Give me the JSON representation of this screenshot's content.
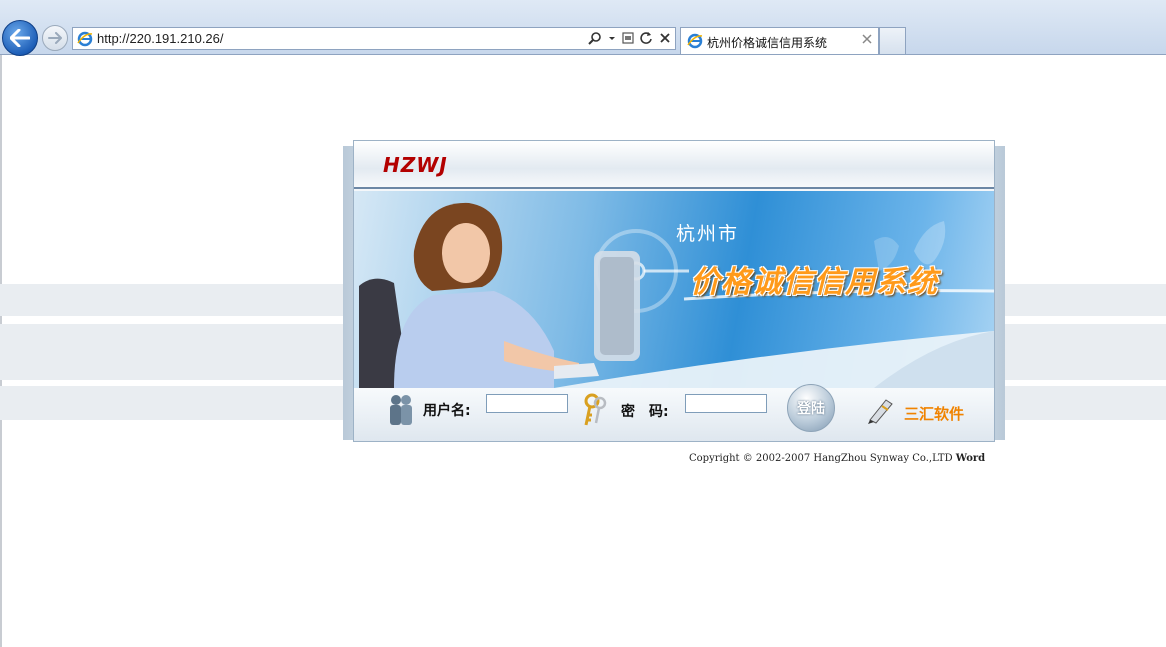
{
  "browser": {
    "url": "http://220.191.210.26/",
    "tab_title": "杭州价格诚信信用系统"
  },
  "login": {
    "brand": "HZWJ",
    "banner_subtitle": "杭州市",
    "banner_title": "价格诚信信用系统",
    "username_label": "用户名:",
    "username_value": "",
    "password_label": "密　码:",
    "password_value": "",
    "login_button": "登陆",
    "vendor": "三汇软件"
  },
  "footer": {
    "copyright": "Copyright © 2002-2007 HangZhou Synway Co.,LTD",
    "copyright_tail": "Word"
  },
  "colors": {
    "brand_red": "#b30000",
    "title_orange": "#ff9a1a",
    "vendor_orange": "#f08300"
  },
  "icons": [
    "back-arrow-icon",
    "forward-arrow-icon",
    "ie-icon",
    "search-icon",
    "dropdown-icon",
    "compat-icon",
    "refresh-icon",
    "stop-icon",
    "close-icon",
    "users-icon",
    "keys-icon",
    "pen-icon"
  ]
}
